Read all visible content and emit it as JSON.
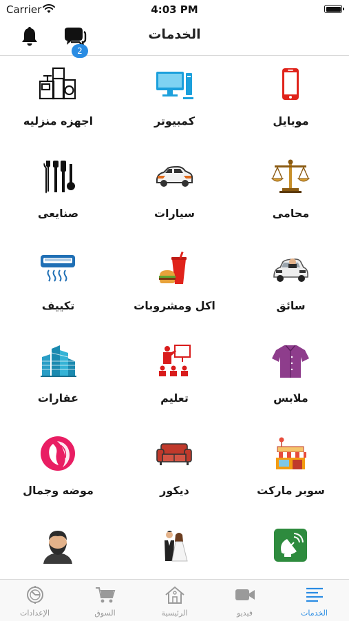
{
  "status_bar": {
    "carrier": "Carrier",
    "time": "4:03 PM"
  },
  "header": {
    "title": "الخدمات",
    "chat_badge": "2"
  },
  "services": [
    {
      "label": "موبايل",
      "icon": "mobile-phone-icon"
    },
    {
      "label": "كمبيوتر",
      "icon": "computer-icon"
    },
    {
      "label": "اجهزه منزليه",
      "icon": "home-appliances-icon"
    },
    {
      "label": "محامى",
      "icon": "scales-icon"
    },
    {
      "label": "سيارات",
      "icon": "car-icon"
    },
    {
      "label": "صنايعى",
      "icon": "tools-icon"
    },
    {
      "label": "سائق",
      "icon": "driver-icon"
    },
    {
      "label": "اكل ومشروبات",
      "icon": "food-drink-icon"
    },
    {
      "label": "تكييف",
      "icon": "air-conditioner-icon"
    },
    {
      "label": "ملابس",
      "icon": "shirt-icon"
    },
    {
      "label": "تعليم",
      "icon": "teaching-icon"
    },
    {
      "label": "عقارات",
      "icon": "buildings-icon"
    },
    {
      "label": "سوبر ماركت",
      "icon": "supermarket-icon"
    },
    {
      "label": "ديكور",
      "icon": "sofa-icon"
    },
    {
      "label": "موضه وجمال",
      "icon": "beauty-icon"
    },
    {
      "label": "",
      "icon": "satellite-dish-icon"
    },
    {
      "label": "",
      "icon": "wedding-couple-icon"
    },
    {
      "label": "",
      "icon": "bearded-man-icon"
    }
  ],
  "tabs": [
    {
      "label": "الخدمات",
      "icon": "list-icon",
      "active": true
    },
    {
      "label": "فيديو",
      "icon": "video-camera-icon",
      "active": false
    },
    {
      "label": "الرئيسية",
      "icon": "home-icon",
      "active": false
    },
    {
      "label": "السوق",
      "icon": "cart-icon",
      "active": false
    },
    {
      "label": "الإعدادات",
      "icon": "settings-icon",
      "active": false
    }
  ],
  "colors": {
    "accent": "#2a8ce3",
    "inactive_tab": "#9a9a9a"
  }
}
